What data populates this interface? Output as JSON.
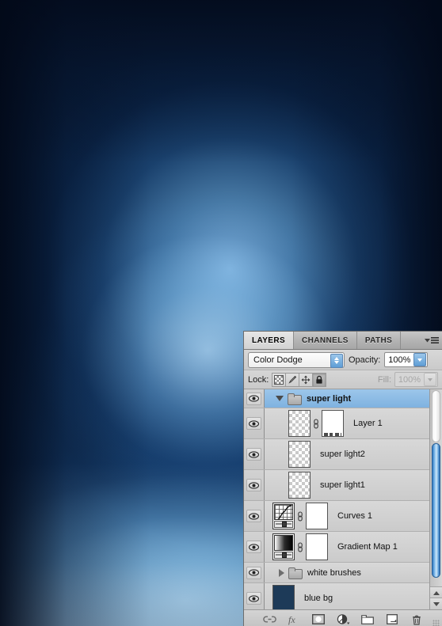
{
  "background": {
    "name": "blue-radial-glow-artwork",
    "colors": {
      "deep": "#0a2344",
      "mid": "#2e6ca8",
      "light": "#bcdcf3",
      "edge": "#041022"
    }
  },
  "panel": {
    "tabs": [
      {
        "id": "layers",
        "label": "LAYERS",
        "active": true
      },
      {
        "id": "channels",
        "label": "CHANNELS",
        "active": false
      },
      {
        "id": "paths",
        "label": "PATHS",
        "active": false
      }
    ],
    "menu_icon": "panel-menu-icon",
    "blend": {
      "mode_value": "Color Dodge",
      "opacity_label": "Opacity:",
      "opacity_value": "100%"
    },
    "lock": {
      "label": "Lock:",
      "buttons": [
        {
          "id": "lock-transparent",
          "icon": "checkerboard-icon",
          "active": false
        },
        {
          "id": "lock-image",
          "icon": "brush-icon",
          "active": false
        },
        {
          "id": "lock-position",
          "icon": "move-icon",
          "active": false
        },
        {
          "id": "lock-all",
          "icon": "lock-icon",
          "active": true
        }
      ],
      "fill_label": "Fill:",
      "fill_value": "100%"
    },
    "layers": [
      {
        "name": "super light",
        "type": "group",
        "selected": true,
        "expanded": true,
        "visible": true
      },
      {
        "name": "Layer 1",
        "type": "pixel",
        "selected": false,
        "masked": true,
        "visible": true,
        "indent": true
      },
      {
        "name": "super light2",
        "type": "pixel",
        "selected": false,
        "visible": true,
        "indent": true
      },
      {
        "name": "super light1",
        "type": "pixel",
        "selected": false,
        "visible": true,
        "indent": true
      },
      {
        "name": "Curves 1",
        "type": "curves",
        "selected": false,
        "masked": true,
        "visible": true
      },
      {
        "name": "Gradient Map 1",
        "type": "gradmap",
        "selected": false,
        "masked": true,
        "visible": true
      },
      {
        "name": "white brushes",
        "type": "group",
        "selected": false,
        "expanded": false,
        "visible": true
      },
      {
        "name": "blue bg",
        "type": "solid",
        "selected": false,
        "visible": true,
        "color": "#1d3a58"
      }
    ],
    "toolbar": [
      {
        "id": "link-layers",
        "icon": "link-icon",
        "label": "Link layers"
      },
      {
        "id": "layer-style",
        "icon": "fx-icon",
        "label": "Add a layer style"
      },
      {
        "id": "add-mask",
        "icon": "add-mask-icon",
        "label": "Add layer mask"
      },
      {
        "id": "adjustment-layer",
        "icon": "half-circle-icon",
        "label": "Create new fill or adjustment layer"
      },
      {
        "id": "new-group",
        "icon": "folder-icon",
        "label": "Create a new group"
      },
      {
        "id": "new-layer",
        "icon": "new-layer-icon",
        "label": "Create a new layer"
      },
      {
        "id": "delete-layer",
        "icon": "trash-icon",
        "label": "Delete layer"
      }
    ],
    "scrollbar": {
      "name": "layers-vertical-scrollbar"
    }
  }
}
